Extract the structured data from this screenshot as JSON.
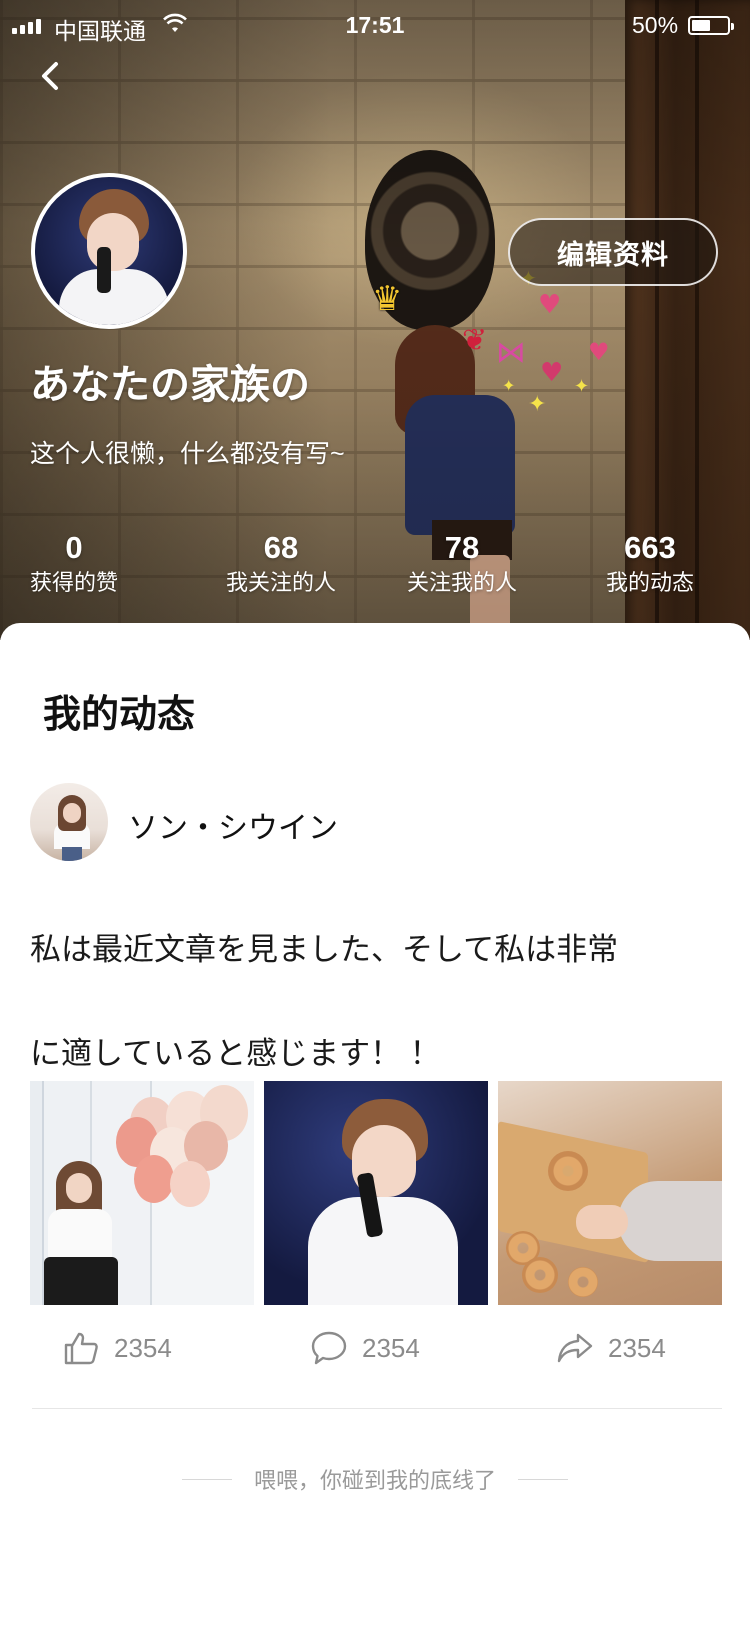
{
  "status_bar": {
    "carrier": "中国联通",
    "time": "17:51",
    "battery_percent": "50%",
    "battery_level": 0.5
  },
  "profile": {
    "nickname": "あなたの家族の",
    "bio": "这个人很懒，什么都没有写~",
    "edit_button": "编辑资料",
    "stats": [
      {
        "value": "0",
        "label": "获得的赞"
      },
      {
        "value": "68",
        "label": "我关注的人"
      },
      {
        "value": "78",
        "label": "关注我的人"
      },
      {
        "value": "663",
        "label": "我的动态"
      }
    ]
  },
  "feed": {
    "section_title": "我的动态",
    "post": {
      "username": "ソン・シウイン",
      "text_line1": "私は最近文章を見ました、そして私は非常",
      "text_line2": "に適していると感じます！ ！",
      "actions": {
        "like_count": "2354",
        "comment_count": "2354",
        "share_count": "2354"
      }
    },
    "end_note": "喂喂，你碰到我的底线了"
  },
  "icons": {
    "back": "back-arrow-icon",
    "like": "thumbs-up-icon",
    "comment": "comment-bubble-icon",
    "share": "share-arrow-icon",
    "wifi": "wifi-icon",
    "battery": "battery-icon",
    "signal": "signal-icon"
  },
  "colors": {
    "text_primary": "#111111",
    "text_secondary": "#8b8b8b",
    "divider": "#e6e6e6"
  }
}
